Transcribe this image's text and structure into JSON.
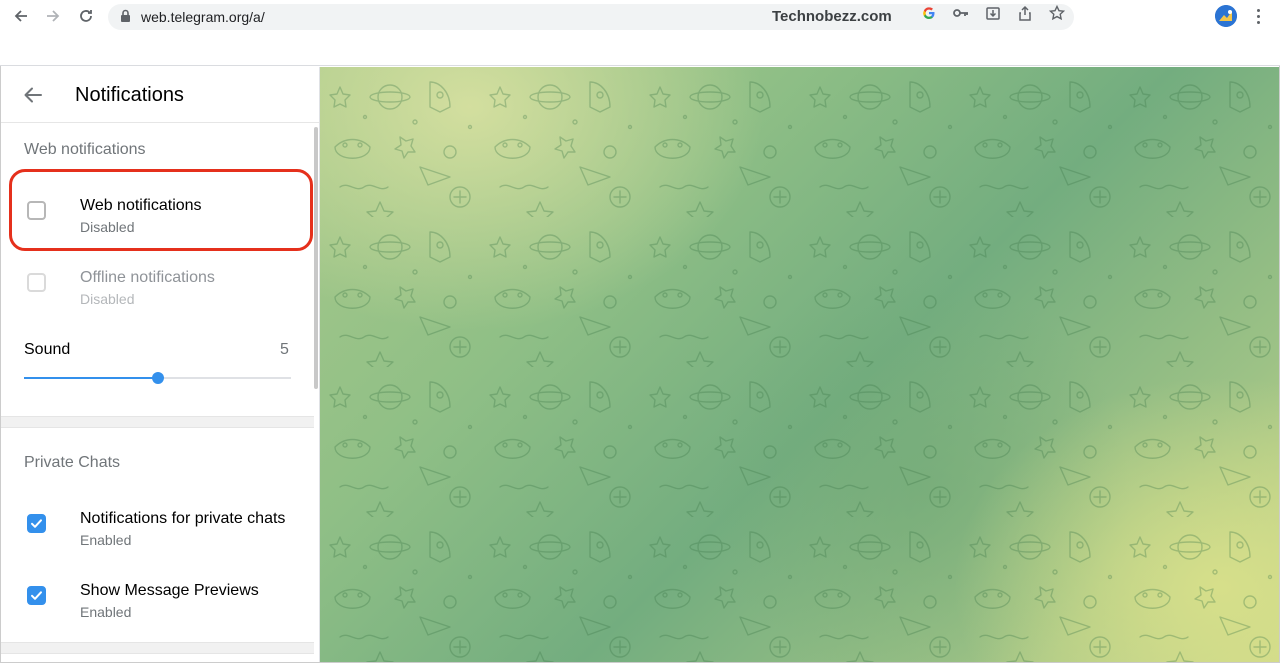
{
  "browser": {
    "url": "web.telegram.org/a/",
    "watermark": "Technobezz.com"
  },
  "panel": {
    "title": "Notifications"
  },
  "web_notifications_section": {
    "title": "Web notifications",
    "items": [
      {
        "label": "Web notifications",
        "status": "Disabled",
        "checked": false,
        "enabled": true
      },
      {
        "label": "Offline notifications",
        "status": "Disabled",
        "checked": false,
        "enabled": false
      }
    ],
    "sound": {
      "label": "Sound",
      "value": "5",
      "level_fraction": 0.5
    }
  },
  "private_chats_section": {
    "title": "Private Chats",
    "items": [
      {
        "label": "Notifications for private chats",
        "status": "Enabled",
        "checked": true
      },
      {
        "label": "Show Message Previews",
        "status": "Enabled",
        "checked": true
      }
    ]
  },
  "colors": {
    "accent": "#3390ec",
    "highlight": "#e5301c"
  }
}
